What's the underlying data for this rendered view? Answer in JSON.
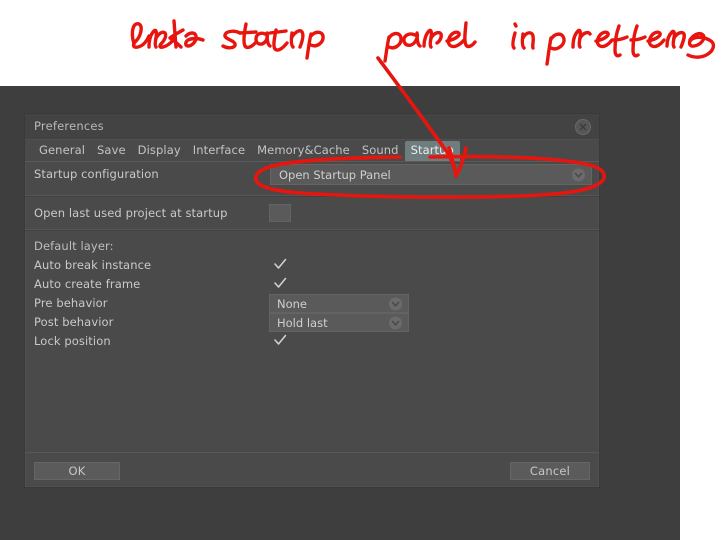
{
  "annotation": {
    "handwritten_note": "Enable startup panel in preference",
    "color": "#e8150f",
    "marks": [
      "handwritten-text",
      "arrow-pointing-to-dropdown",
      "ellipse-around-dropdown"
    ]
  },
  "dialog": {
    "title": "Preferences",
    "close_icon": "close-icon",
    "tabs": [
      {
        "label": "General",
        "active": false
      },
      {
        "label": "Save",
        "active": false
      },
      {
        "label": "Display",
        "active": false
      },
      {
        "label": "Interface",
        "active": false
      },
      {
        "label": "Memory&Cache",
        "active": false
      },
      {
        "label": "Sound",
        "active": false
      },
      {
        "label": "Startup",
        "active": true
      }
    ],
    "settings": {
      "startup_configuration": {
        "label": "Startup configuration",
        "value": "Open Startup Panel",
        "control": "dropdown"
      },
      "open_last_used_project": {
        "label": "Open last used project at startup",
        "checked": false,
        "control": "checkbox"
      },
      "default_layer_header": "Default layer:",
      "auto_break_instance": {
        "label": "Auto break instance",
        "checked": true,
        "control": "checkbox"
      },
      "auto_create_frame": {
        "label": "Auto create frame",
        "checked": true,
        "control": "checkbox"
      },
      "pre_behavior": {
        "label": "Pre behavior",
        "value": "None",
        "control": "dropdown"
      },
      "post_behavior": {
        "label": "Post behavior",
        "value": "Hold last",
        "control": "dropdown"
      },
      "lock_position": {
        "label": "Lock position",
        "checked": true,
        "control": "checkbox"
      }
    },
    "footer": {
      "ok_label": "OK",
      "cancel_label": "Cancel"
    }
  },
  "theme": {
    "window_bg": "#3e3e3e",
    "dialog_bg": "#4a4a4a",
    "titlebar_bg": "#434343",
    "active_tab_bg": "#6f7d7e",
    "control_bg": "#5a5a5a",
    "text": "#c9c9c9",
    "annotation_red": "#e8150f"
  }
}
